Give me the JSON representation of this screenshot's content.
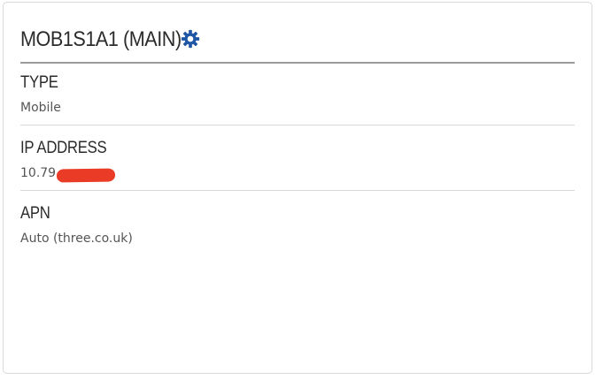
{
  "card": {
    "title": "MOB1S1A1 (MAIN)",
    "settings_icon": "gear-icon",
    "accent_color": "#1f57a6"
  },
  "fields": [
    {
      "label": "TYPE",
      "value": "Mobile"
    },
    {
      "label": "IP ADDRESS",
      "value": "10.79.",
      "redacted": true,
      "redaction_color": "#ea3b26"
    },
    {
      "label": "APN",
      "value": "Auto (three.co.uk)"
    }
  ]
}
